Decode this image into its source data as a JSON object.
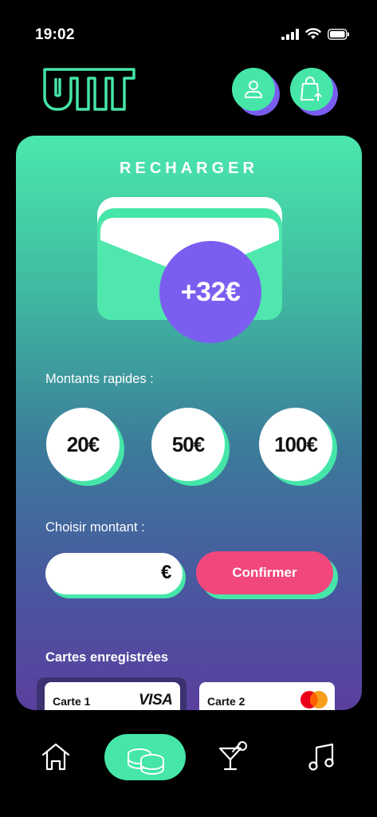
{
  "status_bar": {
    "time": "19:02"
  },
  "header": {
    "logo_icon": "umi-logo",
    "profile_icon": "user-icon",
    "bag_icon": "shopping-bag-upload-icon"
  },
  "recharge": {
    "title": "RECHARGER",
    "balance_badge": "+32€",
    "quick_amounts_label": "Montants rapides :",
    "quick_amounts": [
      "20€",
      "50€",
      "100€"
    ],
    "choose_amount_label": "Choisir montant :",
    "amount_input": {
      "value": "",
      "placeholder": "",
      "currency_symbol": "€"
    },
    "confirm_label": "Confirmer",
    "saved_cards_label": "Cartes enregistrées",
    "saved_cards": [
      {
        "name": "Carte 1",
        "brand": "VISA"
      },
      {
        "name": "Carte 2",
        "brand": "mastercard-icon"
      }
    ]
  },
  "nav": {
    "items": [
      {
        "icon": "home-icon",
        "active": false
      },
      {
        "icon": "coins-icon",
        "active": true
      },
      {
        "icon": "cocktail-icon",
        "active": false
      },
      {
        "icon": "music-note-icon",
        "active": false
      }
    ]
  },
  "colors": {
    "accent_green": "#45e6a8",
    "accent_purple": "#7b5ef0",
    "confirm_pink": "#f2477d",
    "background": "#000000"
  }
}
